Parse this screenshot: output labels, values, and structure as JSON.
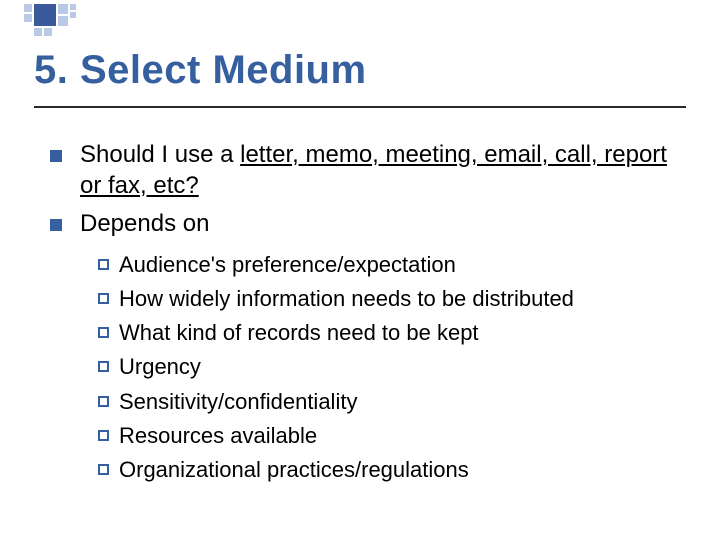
{
  "title": "5. Select Medium",
  "bullets": [
    {
      "plain": "Should I use a ",
      "underlined": "letter, memo, meeting, email, call, report or fax, etc?"
    },
    {
      "plain": "Depends on",
      "underlined": ""
    }
  ],
  "sub_bullets": [
    "Audience's preference/expectation",
    "How widely information needs to be distributed",
    "What kind of records need to be kept",
    "Urgency",
    "Sensitivity/confidentiality",
    "Resources available",
    "Organizational practices/regulations"
  ]
}
